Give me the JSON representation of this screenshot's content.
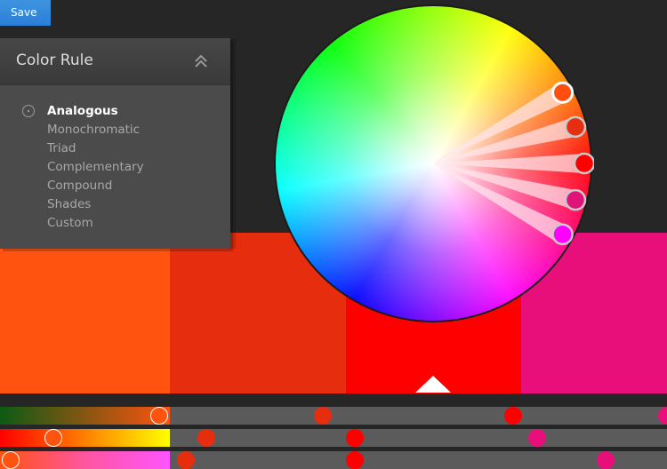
{
  "toolbar": {
    "save_label": "Save",
    "save_color": "#2f86d9"
  },
  "panel": {
    "title": "Color Rule",
    "collapse_icon": "double-chevron-up-icon",
    "rules": [
      {
        "label": "Analogous",
        "active": true
      },
      {
        "label": "Monochromatic",
        "active": false
      },
      {
        "label": "Triad",
        "active": false
      },
      {
        "label": "Complementary",
        "active": false
      },
      {
        "label": "Compound",
        "active": false
      },
      {
        "label": "Shades",
        "active": false
      },
      {
        "label": "Custom",
        "active": false
      }
    ]
  },
  "swatches": [
    {
      "color": "#ff530f"
    },
    {
      "color": "#e62e0f"
    },
    {
      "color": "#ff0000",
      "selected": true
    },
    {
      "color": "#e80f7a"
    }
  ],
  "wheel": {
    "handles": [
      {
        "color": "#ff4e10",
        "base": true
      },
      {
        "color": "#e62e10"
      },
      {
        "color": "#ff0000"
      },
      {
        "color": "#e0137a"
      },
      {
        "color": "#ff00ff"
      }
    ]
  },
  "sliders": [
    {
      "name": "hue",
      "gradient": [
        "#0c5a14",
        "#ff530f"
      ],
      "active_knob": {
        "value": 0.238,
        "color": "#ff530f"
      },
      "knobs": [
        {
          "value": 0.484,
          "color": "#e62e0f"
        },
        {
          "value": 0.769,
          "color": "#ff0000"
        },
        {
          "value": 1.0,
          "color": "#e80f7a"
        }
      ]
    },
    {
      "name": "saturation",
      "gradient": [
        "#ff0000",
        "#ff8000",
        "#ffff00"
      ],
      "active_knob": {
        "value": 0.08,
        "color": "#ff530f"
      },
      "knobs": [
        {
          "value": 0.309,
          "color": "#e62e0f"
        },
        {
          "value": 0.532,
          "color": "#ff0000"
        },
        {
          "value": 0.805,
          "color": "#e80f7a"
        }
      ]
    },
    {
      "name": "brightness",
      "gradient": [
        "#ff530f",
        "#ff55a0",
        "#ff55ff"
      ],
      "active_knob": {
        "value": 0.016,
        "color": "#ff530f"
      },
      "knobs": [
        {
          "value": 0.278,
          "color": "#e62e0f"
        },
        {
          "value": 0.532,
          "color": "#ff0000"
        },
        {
          "value": 0.908,
          "color": "#e80f7a"
        }
      ]
    }
  ]
}
